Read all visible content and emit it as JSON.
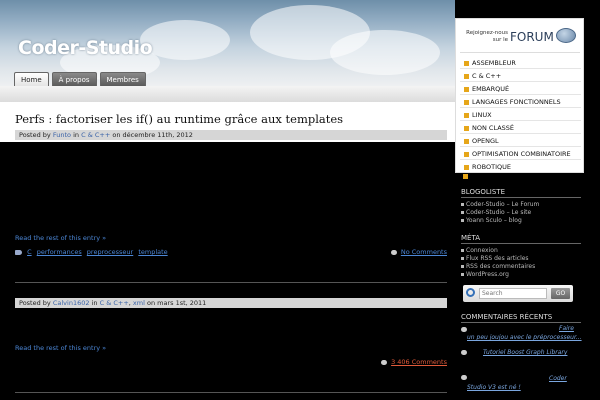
{
  "header": {
    "site_title": "Coder-Studio",
    "nav": [
      "Home",
      "À propos",
      "Membres"
    ]
  },
  "posts": [
    {
      "title": "Perfs : factoriser les if() au runtime grâce aux templates",
      "meta_posted_by": "Posted by",
      "author": "Funto",
      "in": "in",
      "categories": "C & C++",
      "on": "on décembre 11th, 2012",
      "read_more": "Read the rest of this entry »",
      "tags": [
        "C",
        "performances",
        "preprocesseur",
        "template"
      ],
      "comments": "No Comments"
    },
    {
      "meta_posted_by": "Posted by",
      "author": "Calvin1602",
      "in": "in",
      "categories": "C & C++",
      "categories2": "xml",
      "on": "on mars 1st, 2011",
      "read_more": "Read the rest of this entry »",
      "comments": "3 406 Comments"
    }
  ],
  "sidebar": {
    "forum": {
      "join_text": "Rejoignez-nous sur le",
      "label": "FORUM"
    },
    "categories": [
      "ASSEMBLEUR",
      "C & C++",
      "EMBARQUÉ",
      "LANGAGES FONCTIONNELS",
      "LINUX",
      "NON CLASSÉ",
      "OPENGL",
      "OPTIMISATION COMBINATOIRE",
      "ROBOTIQUE"
    ],
    "blogoliste": {
      "title": "BLOGOLISTE",
      "links": [
        "Coder-Studio – Le Forum",
        "Coder-Studio – Le site",
        "Yoann Sculo – blog"
      ]
    },
    "meta": {
      "title": "MÉTA",
      "links": [
        "Connexion",
        "Flux RSS des articles",
        "RSS des commentaires",
        "WordPress.org"
      ]
    },
    "search": {
      "placeholder": "Search",
      "go": "GO"
    },
    "recent_comments": {
      "title": "COMMENTAIRES RÉCENTS",
      "items": [
        "Faire",
        "un peu joujou avec le préprocesseur...",
        "Tutoriel Boost Graph Library",
        "Coder",
        "Studio V3 est né !"
      ]
    }
  },
  "colors": {
    "link": "#4c87d6",
    "category_bullet": "#e6a619",
    "meta_bar": "#d6d6d6"
  }
}
